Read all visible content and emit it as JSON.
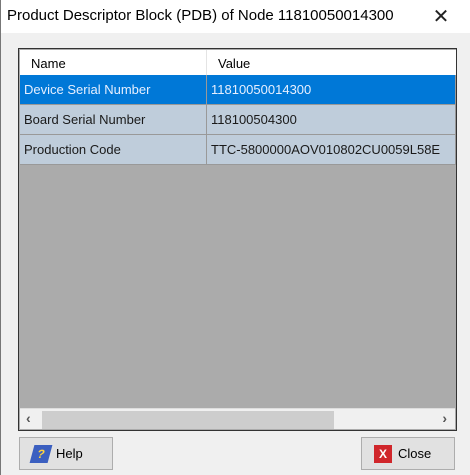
{
  "window": {
    "title": "Product Descriptor Block (PDB) of Node 11810050014300"
  },
  "grid": {
    "columns": [
      "Name",
      "Value"
    ],
    "rows": [
      {
        "name": "Device Serial Number",
        "value": "11810050014300",
        "selected": true
      },
      {
        "name": "Board Serial Number",
        "value": "118100504300",
        "selected": false
      },
      {
        "name": "Production Code",
        "value": "TTC-5800000AOV010802CU0059L58E",
        "selected": false
      }
    ]
  },
  "buttons": {
    "help": "Help",
    "close": "Close"
  },
  "colors": {
    "selection": "#0078d7",
    "row": "#bfcddb",
    "empty": "#ababab"
  }
}
